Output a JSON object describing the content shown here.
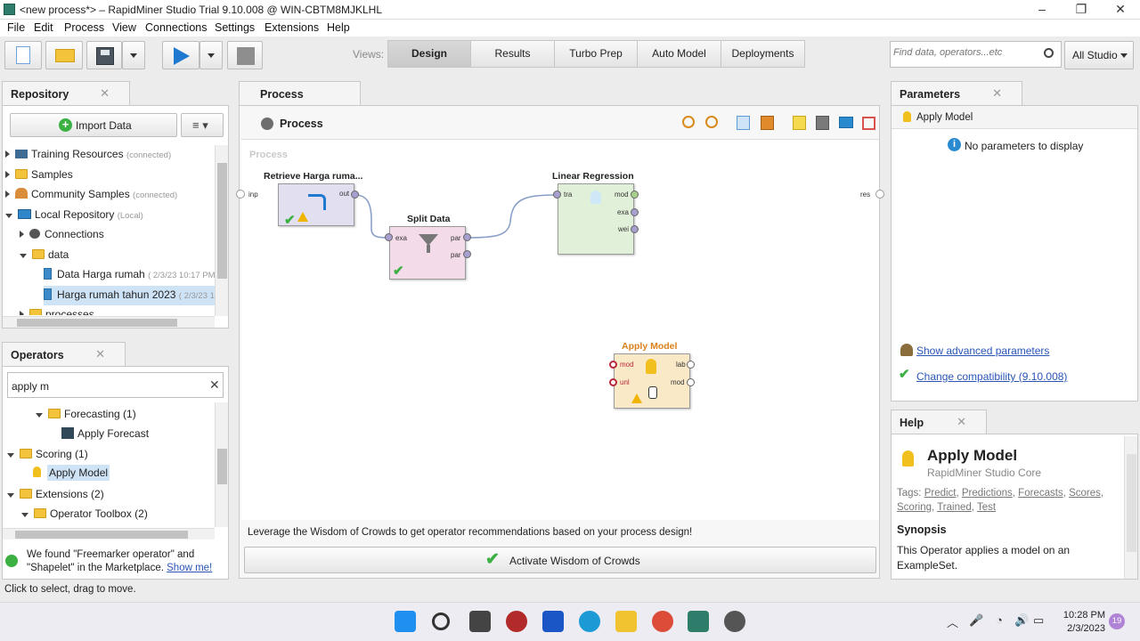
{
  "window": {
    "title": "<new process*> – RapidMiner Studio Trial 9.10.008 @ WIN-CBTM8MJKLHL",
    "min": "–",
    "max": "❐",
    "close": "✕"
  },
  "menu": [
    "File",
    "Edit",
    "Process",
    "View",
    "Connections",
    "Settings",
    "Extensions",
    "Help"
  ],
  "toolbar": {
    "views_label": "Views:",
    "views": [
      "Design",
      "Results",
      "Turbo Prep",
      "Auto Model",
      "Deployments"
    ],
    "active_view": "Design",
    "search_placeholder": "Find data, operators...etc",
    "scope": "All Studio"
  },
  "repository": {
    "tab": "Repository",
    "import_button": "Import Data",
    "items": [
      {
        "label": "Training Resources",
        "note": "(connected)"
      },
      {
        "label": "Samples",
        "note": ""
      },
      {
        "label": "Community Samples",
        "note": "(connected)"
      },
      {
        "label": "Local Repository",
        "note": "(Local)"
      },
      {
        "label": "Connections",
        "note": ""
      },
      {
        "label": "data",
        "note": ""
      },
      {
        "label": "Data Harga rumah",
        "note": "( 2/3/23 10:17 PM"
      },
      {
        "label": "Harga rumah tahun 2023",
        "note": "( 2/3/23 1"
      },
      {
        "label": "processes",
        "note": ""
      }
    ]
  },
  "operators": {
    "tab": "Operators",
    "search_value": "apply m",
    "items": [
      "Forecasting (1)",
      "Apply Forecast",
      "Scoring (1)",
      "Apply Model",
      "Extensions (2)",
      "Operator Toolbox (2)"
    ],
    "marketplace_msg_1": "We found \"Freemarker operator\" and",
    "marketplace_msg_2": "\"Shapelet\" in the Marketplace.",
    "show_me": "Show me!"
  },
  "process": {
    "tab": "Process",
    "breadcrumb": "Process",
    "canvas_label": "Process",
    "input_port": "inp",
    "result_port": "res",
    "operators": [
      {
        "name": "Retrieve Harga ruma...",
        "ports_out": [
          "out"
        ]
      },
      {
        "name": "Split Data",
        "ports_in": [
          "exa"
        ],
        "ports_out": [
          "par",
          "par"
        ]
      },
      {
        "name": "Linear Regression",
        "ports_in": [
          "tra"
        ],
        "ports_out": [
          "mod",
          "exa",
          "wei"
        ]
      },
      {
        "name": "Apply Model",
        "ports_in": [
          "mod",
          "unl"
        ],
        "ports_out": [
          "lab",
          "mod"
        ]
      }
    ],
    "wisdom_msg": "Leverage the Wisdom of Crowds to get operator recommendations based on your process design!",
    "wisdom_button": "Activate Wisdom of Crowds"
  },
  "parameters": {
    "tab": "Parameters",
    "operator": "Apply Model",
    "none": "No parameters to display",
    "show_advanced": "Show advanced parameters",
    "compat": "Change compatibility (9.10.008)"
  },
  "help": {
    "tab": "Help",
    "title": "Apply Model",
    "subtitle": "RapidMiner Studio Core",
    "tags_label": "Tags:",
    "tags": [
      "Predict",
      "Predictions",
      "Forecasts",
      "Scores",
      "Scoring",
      "Trained",
      "Test"
    ],
    "synopsis_label": "Synopsis",
    "synopsis": "This Operator applies a model on an ExampleSet."
  },
  "status": "Click to select, drag to move.",
  "taskbar": {
    "time": "10:28 PM",
    "date": "2/3/2023",
    "badge": "19"
  },
  "colors": {
    "accent_blue": "#2a55b6",
    "retrieve_op": "#e2dff0",
    "split_op": "#f3dbe9",
    "lr_op": "#e1f0d8",
    "apply_op": "#f9e9c6",
    "apply_title": "#d9801a"
  }
}
